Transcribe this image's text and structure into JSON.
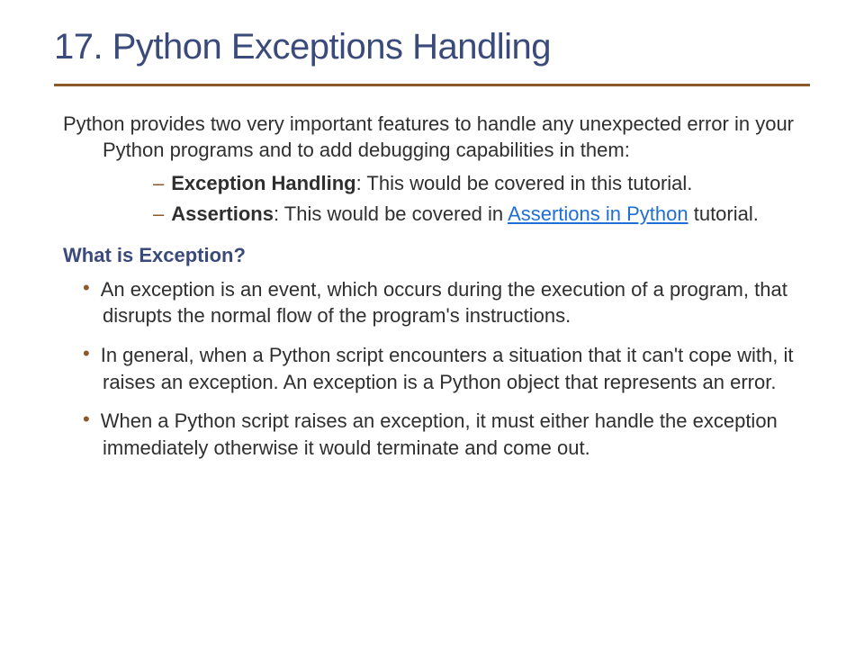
{
  "title": "17. Python Exceptions Handling",
  "intro": "Python provides two very important features to handle any unexpected error in your Python programs and to add debugging capabilities in them:",
  "features": [
    {
      "lead": "Exception Handling",
      "rest": ": This would be covered in this tutorial."
    },
    {
      "lead": "Assertions",
      "rest_before": ": This would be covered in ",
      "link": "Assertions in Python",
      "rest_after": " tutorial."
    }
  ],
  "subheading": "What is Exception?",
  "bullets": [
    "An exception is an event, which occurs during the execution of a program, that disrupts the normal flow of the program's instructions.",
    "In general, when a Python script encounters a situation that it can't cope with, it raises an exception. An exception is a Python object that represents an error.",
    "When a Python script raises an exception, it must either handle the exception immediately otherwise it would terminate and come out."
  ]
}
